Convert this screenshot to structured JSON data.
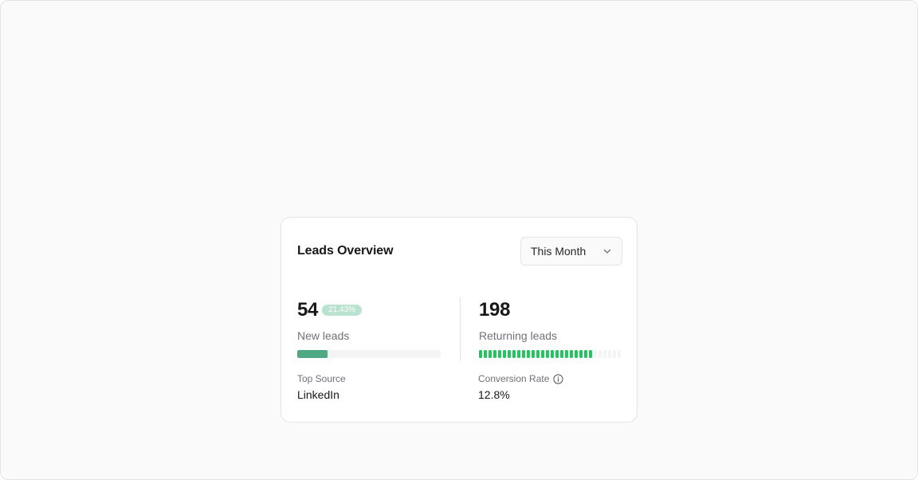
{
  "card": {
    "title": "Leads Overview",
    "period_select": {
      "value": "This Month",
      "icon": "chevron-down-icon"
    }
  },
  "new_leads": {
    "value": "54",
    "change_badge": "21.43%",
    "label": "New leads",
    "progress_fraction": 0.21,
    "bar_color": "#4fa982"
  },
  "returning_leads": {
    "value": "198",
    "label": "Returning leads",
    "segments_total": 30,
    "segments_filled": 24,
    "filled_color": "#22c55e",
    "empty_color": "#f4f4f5"
  },
  "top_source": {
    "label": "Top Source",
    "value": "LinkedIn"
  },
  "conversion_rate": {
    "label": "Conversion Rate",
    "value": "12.8%",
    "icon": "info-icon"
  }
}
